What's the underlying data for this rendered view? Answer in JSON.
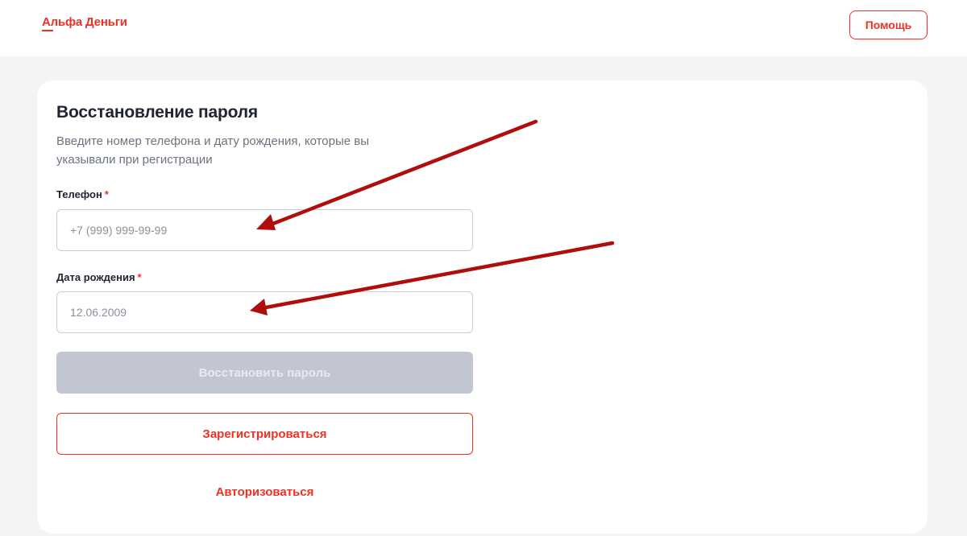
{
  "header": {
    "logo_text": "Альфа Деньги",
    "help_label": "Помощь"
  },
  "form": {
    "title": "Восстановление пароля",
    "subtitle": "Введите номер телефона и дату рождения, которые вы указывали при регистрации",
    "phone": {
      "label": "Телефон",
      "required_mark": "*",
      "value": "",
      "placeholder": "+7 (999) 999-99-99"
    },
    "birth_date": {
      "label": "Дата рождения",
      "required_mark": "*",
      "value": "",
      "placeholder": "12.06.2009"
    },
    "restore_button_label": "Восстановить пароль",
    "restore_button_enabled": false,
    "register_button_label": "Зарегистрироваться",
    "login_link_label": "Авторизоваться"
  },
  "colors": {
    "brand_red": "#ef3124",
    "disabled_button": "#c1c6d1",
    "page_background": "#f3f4f6",
    "annotation_arrow": "#b00d0d"
  },
  "annotations": {
    "arrows_count": 2,
    "arrow_targets": [
      "phone-input",
      "birth-date-input"
    ]
  }
}
